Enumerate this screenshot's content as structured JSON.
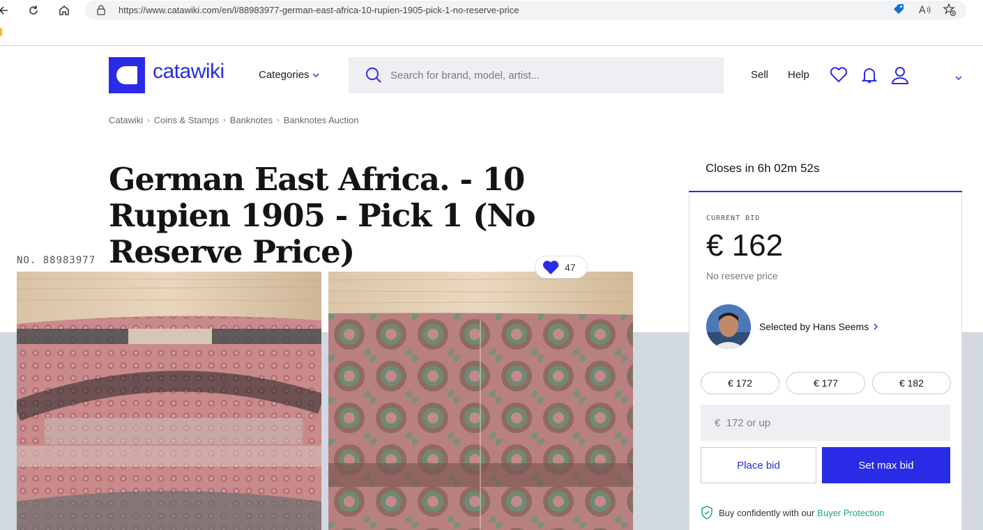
{
  "browser": {
    "url": "https://www.catawiki.com/en/l/88983977-german-east-africa-10-rupien-1905-pick-1-no-reserve-price"
  },
  "header": {
    "logo_text": "catawiki",
    "categories_label": "Categories",
    "search_placeholder": "Search for brand, model, artist...",
    "sell_label": "Sell",
    "help_label": "Help"
  },
  "breadcrumb": [
    "Catawiki",
    "Coins & Stamps",
    "Banknotes",
    "Banknotes Auction"
  ],
  "lot": {
    "title": "German East Africa. - 10 Rupien 1905 - Pick 1 (No Reserve Price)",
    "number": "NO. 88983977",
    "favorites": "47"
  },
  "bidding": {
    "closes": "Closes in 6h 02m 52s",
    "current_bid_label": "CURRENT BID",
    "current_bid": "€ 162",
    "reserve_text": "No reserve price",
    "selected_by": "Selected by Hans Seems",
    "quick_bids": [
      "€ 172",
      "€ 177",
      "€ 182"
    ],
    "input_placeholder": "€  172 or up",
    "place_bid_label": "Place bid",
    "max_bid_label": "Set max bid",
    "protection_text": "Buy confidently with our",
    "protection_link": "Buyer Protection"
  },
  "colors": {
    "brand": "#2a2be6",
    "protection_link": "#1fa38a"
  }
}
